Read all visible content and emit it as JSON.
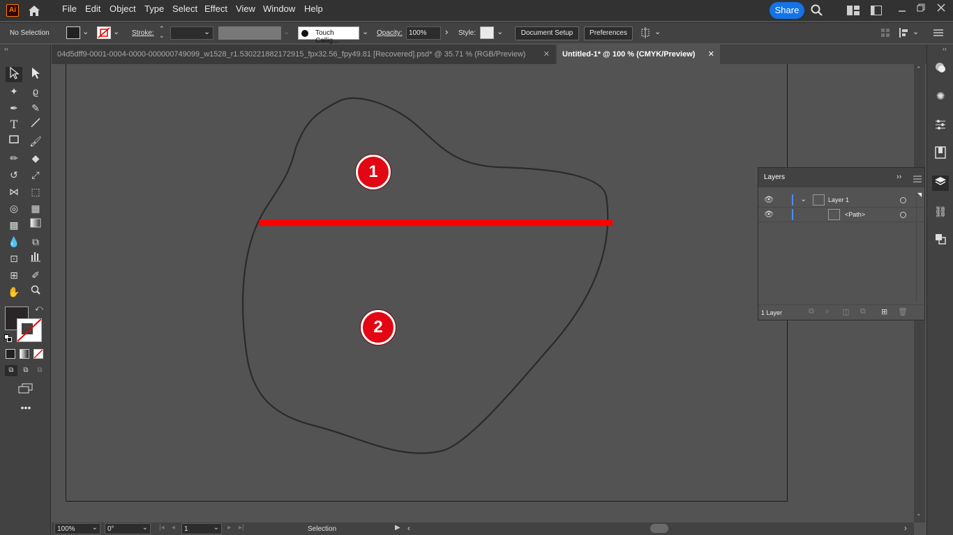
{
  "app": {
    "logo_text": "Ai",
    "menu": [
      "File",
      "Edit",
      "Object",
      "Type",
      "Select",
      "Effect",
      "View",
      "Window",
      "Help"
    ],
    "share_label": "Share"
  },
  "control_bar": {
    "selection_status": "No Selection",
    "stroke_label": "Stroke:",
    "brush_name": "Touch Callig...",
    "opacity_label": "Opacity:",
    "opacity_value": "100%",
    "style_label": "Style:",
    "document_setup_label": "Document Setup",
    "preferences_label": "Preferences"
  },
  "tabs": [
    {
      "label": "04d5dff9-0001-0004-0000-000000749099_w1528_r1.530221882172915_fpx32.56_fpy49.81 [Recovered].psd* @ 35.71 % (RGB/Preview)",
      "close": "✕",
      "active": false
    },
    {
      "label": "Untitled-1* @ 100 % (CMYK/Preview)",
      "close": "✕",
      "active": true
    }
  ],
  "canvas": {
    "markers": [
      {
        "label": "1"
      },
      {
        "label": "2"
      }
    ],
    "cut_line_color": "#ff0000",
    "marker_color": "#e30613"
  },
  "layers_panel": {
    "title": "Layers",
    "rows": [
      {
        "name": "Layer 1",
        "expanded": true
      },
      {
        "name": "<Path>",
        "expanded": false
      }
    ],
    "footer_count": "1 Layer"
  },
  "status_bar": {
    "zoom": "100%",
    "rotation": "0°",
    "artboard_number": "1",
    "tool_name": "Selection"
  },
  "colors": {
    "accent": "#1473e6",
    "layer_color": "#4b8bff"
  }
}
